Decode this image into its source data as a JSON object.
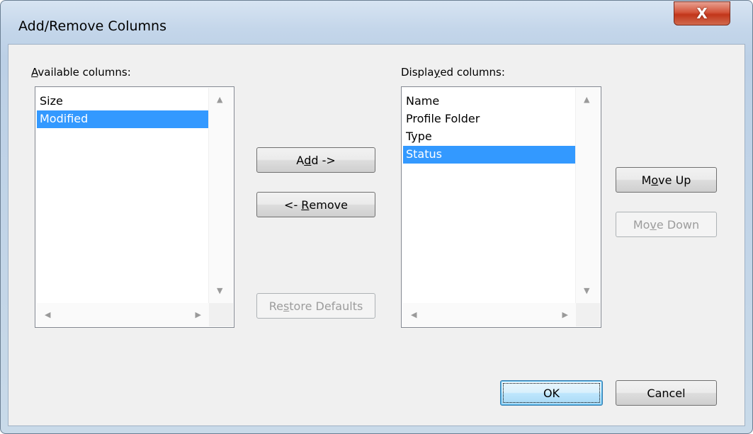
{
  "window": {
    "title": "Add/Remove Columns",
    "close_glyph": "X"
  },
  "available": {
    "label_mnemonic": "A",
    "label_rest": "vailable columns:",
    "items": [
      "Size",
      "Modified"
    ],
    "selected_index": 1
  },
  "displayed": {
    "label_before": "Displa",
    "label_mnemonic": "y",
    "label_after": "ed columns:",
    "items": [
      "Name",
      "Profile Folder",
      "Type",
      "Status"
    ],
    "selected_index": 3
  },
  "buttons": {
    "add": {
      "before": "A",
      "mnemonic": "d",
      "after": "d ->"
    },
    "remove": {
      "before": "<- ",
      "mnemonic": "R",
      "after": "emove"
    },
    "restore": {
      "before": "Re",
      "mnemonic": "s",
      "after": "tore Defaults",
      "enabled": false
    },
    "move_up": {
      "before": "M",
      "mnemonic": "o",
      "after": "ve Up"
    },
    "move_down": {
      "before": "Mo",
      "mnemonic": "v",
      "after": "e Down",
      "enabled": false
    },
    "ok": "OK",
    "cancel": "Cancel"
  },
  "icons": {
    "scroll_up": "scroll-up-arrow-icon",
    "scroll_down": "scroll-down-arrow-icon",
    "scroll_left": "scroll-left-arrow-icon",
    "scroll_right": "scroll-right-arrow-icon"
  },
  "colors": {
    "selection": "#3399ff",
    "close_button": "#c2361a",
    "default_button_border": "#3c7fb1"
  }
}
